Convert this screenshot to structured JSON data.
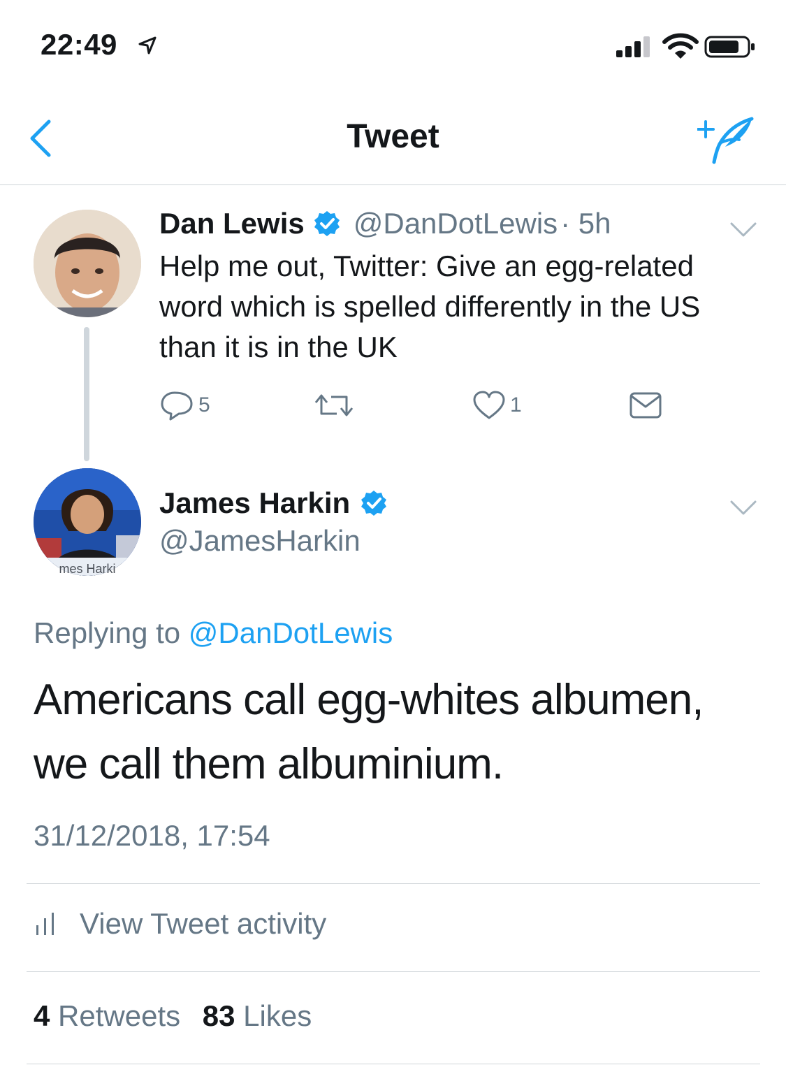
{
  "status_bar": {
    "time": "22:49"
  },
  "nav": {
    "title": "Tweet"
  },
  "parent_tweet": {
    "name": "Dan Lewis",
    "handle": "@DanDotLewis",
    "time": "· 5h",
    "text": "Help me out, Twitter: Give an egg-related word which is spelled differently in the US than it is in the UK",
    "replies": "5",
    "likes": "1"
  },
  "main_tweet": {
    "name": "James Harkin",
    "handle": "@JamesHarkin",
    "avatar_caption": "mes Harki",
    "replying_prefix": "Replying to",
    "replying_to": "@DanDotLewis",
    "text": "Americans call egg-whites albumen, we call them albuminium.",
    "timestamp": "31/12/2018, 17:54",
    "activity_label": "View Tweet activity",
    "retweets_count": "4",
    "retweets_label": "Retweets",
    "likes_count": "83",
    "likes_label": "Likes"
  },
  "colors": {
    "accent": "#1da1f2",
    "secondary_text": "#657786",
    "divider": "#cfd4d8"
  }
}
